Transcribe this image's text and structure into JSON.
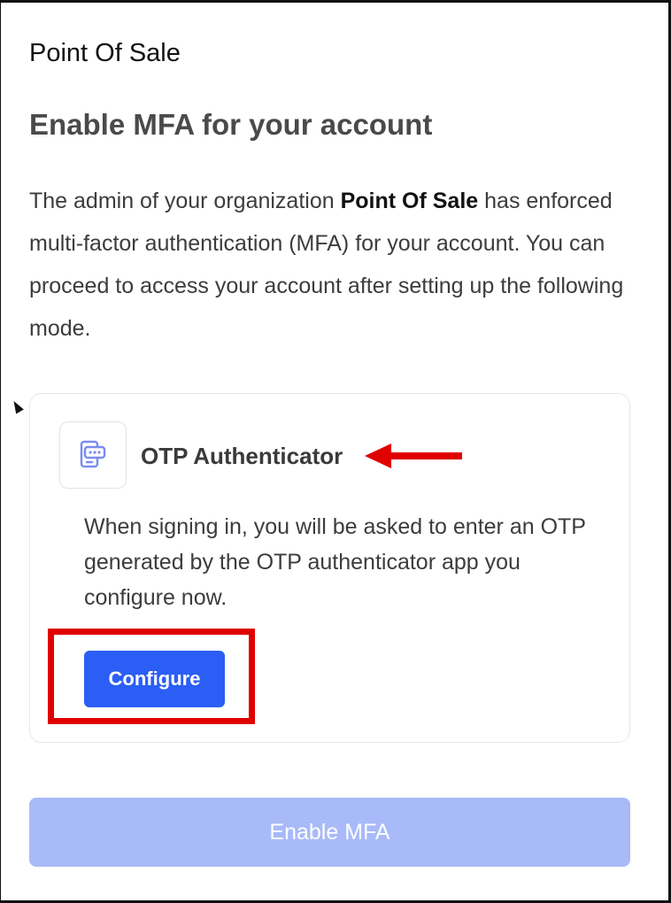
{
  "header": {
    "org_name": "Point Of Sale",
    "page_title": "Enable MFA for your account"
  },
  "description": {
    "before": "The admin of your organization ",
    "org_name": "Point Of Sale",
    "after": " has enforced multi-factor authentication (MFA) for your account. You can proceed to access your account after setting up the following mode."
  },
  "mfa_mode": {
    "icon": "otp-authenticator-icon",
    "title": "OTP Authenticator",
    "description": "When signing in, you will be asked to enter an OTP generated by the OTP authenticator app you configure now.",
    "configure_label": "Configure"
  },
  "footer": {
    "enable_label": "Enable MFA"
  },
  "colors": {
    "primary": "#2b5ef5",
    "primary_disabled": "#a8baf8",
    "annotation": "#e00000",
    "icon": "#7b8cf0"
  }
}
